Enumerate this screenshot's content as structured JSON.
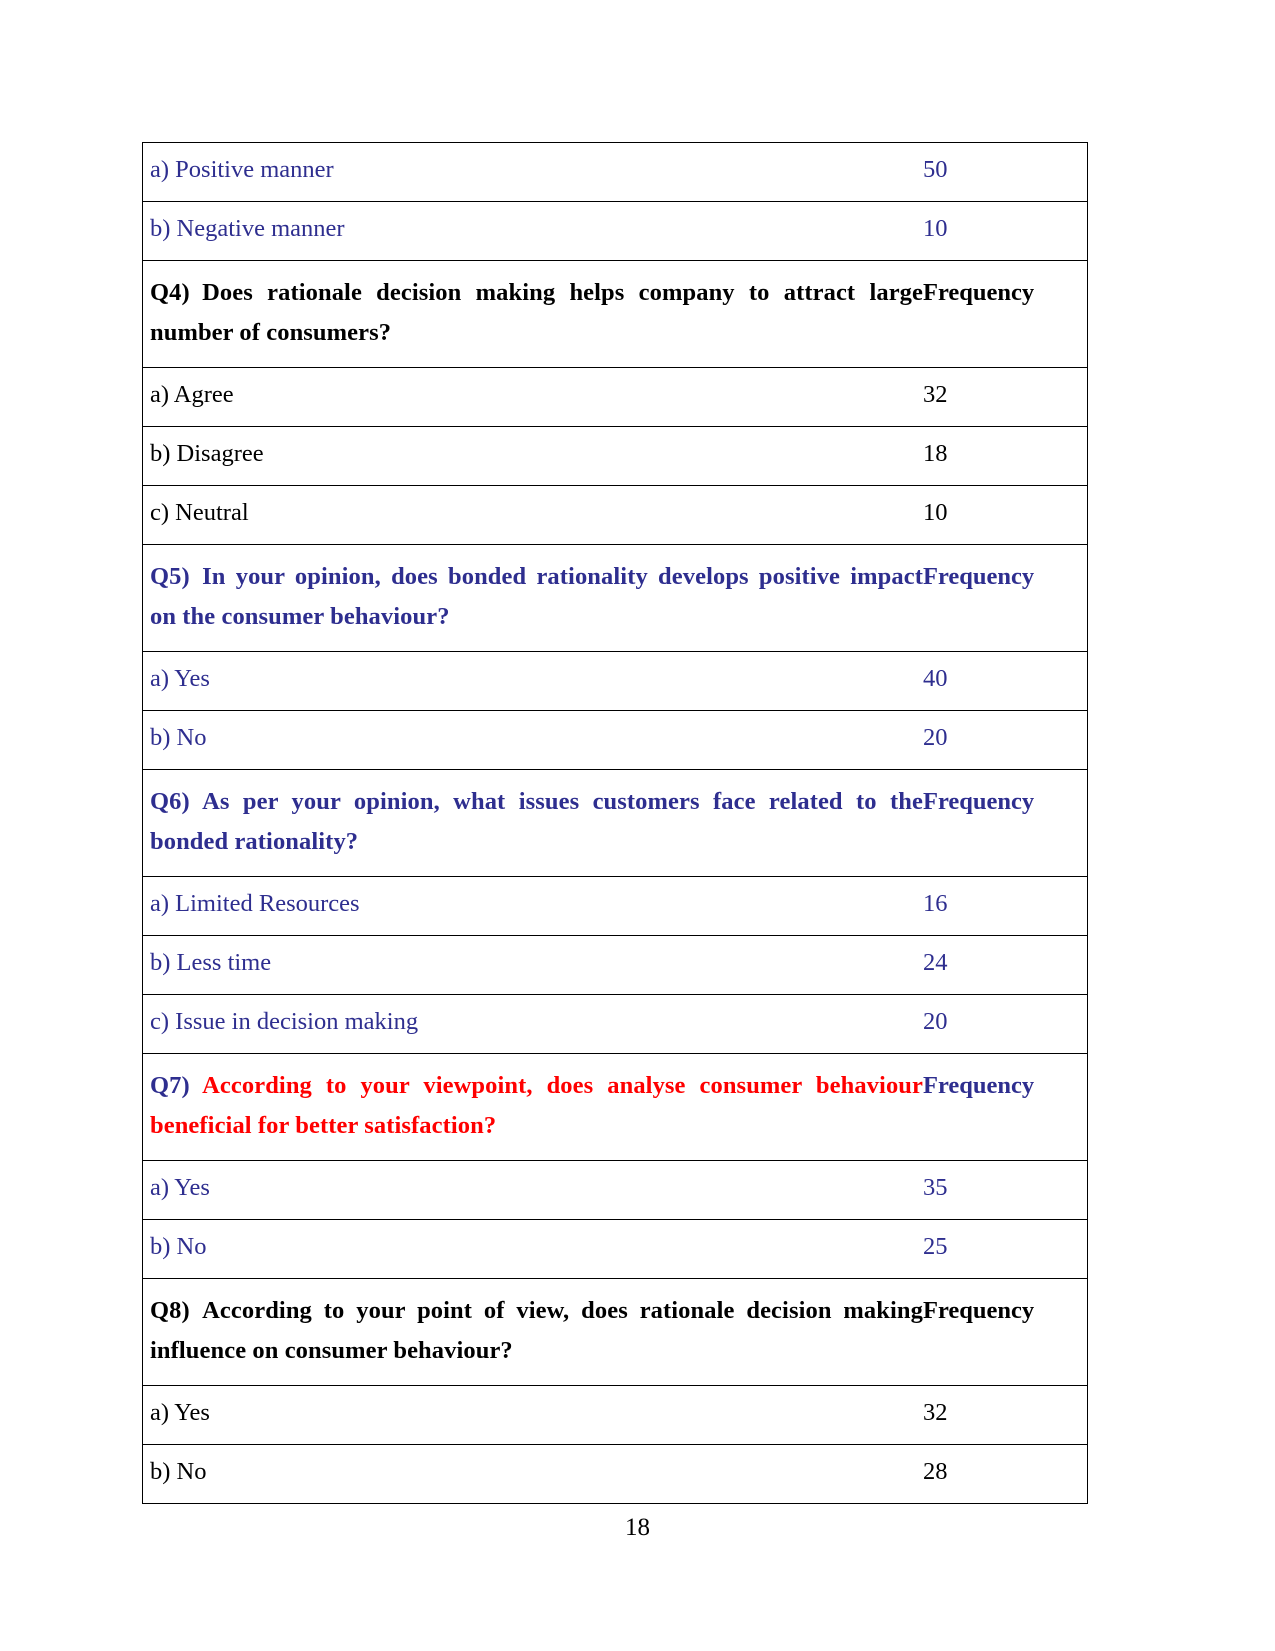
{
  "document": {
    "page_number": "18",
    "colors": {
      "blue": "#2E2E8F",
      "red": "#FF0000",
      "black": "#000000",
      "border": "#000000",
      "background": "#FFFFFF"
    }
  },
  "table": {
    "frequency_header_label": "Frequency",
    "rows": [
      {
        "kind": "answer",
        "label": "a) Positive manner",
        "frequency": "50",
        "label_color": "blue",
        "frequency_color": "blue"
      },
      {
        "kind": "answer",
        "label": "b) Negative manner",
        "frequency": "10",
        "label_color": "blue",
        "frequency_color": "blue"
      },
      {
        "kind": "question",
        "number": "Q4)",
        "number_color": "black",
        "label": "Q4)  Does  rationale  decision  making  helps  company  to  attract  large number of consumers?",
        "question_text": "Does rationale decision making helps company to attract large number of consumers?",
        "frequency": "Frequency",
        "label_color": "black",
        "frequency_color": "black"
      },
      {
        "kind": "answer",
        "label": "a) Agree",
        "frequency": "32",
        "label_color": "black",
        "frequency_color": "black"
      },
      {
        "kind": "answer",
        "label": "b) Disagree",
        "frequency": "18",
        "label_color": "black",
        "frequency_color": "black"
      },
      {
        "kind": "answer",
        "label": "c) Neutral",
        "frequency": "10",
        "label_color": "black",
        "frequency_color": "black"
      },
      {
        "kind": "question",
        "number": "Q5)",
        "number_color": "blue",
        "label": "Q5) In your opinion, does bonded rationality develops positive impact on the consumer behaviour?",
        "question_text": "In your opinion, does bonded rationality develops positive impact on the consumer behaviour?",
        "frequency": "Frequency",
        "label_color": "blue",
        "frequency_color": "blue"
      },
      {
        "kind": "answer",
        "label": "a) Yes",
        "frequency": "40",
        "label_color": "blue",
        "frequency_color": "blue"
      },
      {
        "kind": "answer",
        "label": "b) No",
        "frequency": "20",
        "label_color": "blue",
        "frequency_color": "blue"
      },
      {
        "kind": "question",
        "number": "Q6)",
        "number_color": "blue",
        "label": "Q6) As per your opinion, what issues customers face related to the bonded rationality?",
        "question_text": "As per your opinion, what issues customers face related to the bonded rationality?",
        "frequency": "Frequency",
        "label_color": "blue",
        "frequency_color": "blue"
      },
      {
        "kind": "answer",
        "label": "a) Limited Resources",
        "frequency": "16",
        "label_color": "blue",
        "frequency_color": "blue"
      },
      {
        "kind": "answer",
        "label": "b) Less time",
        "frequency": "24",
        "label_color": "blue",
        "frequency_color": "blue"
      },
      {
        "kind": "answer",
        "label": "c) Issue in decision making",
        "frequency": "20",
        "label_color": "blue",
        "frequency_color": "blue"
      },
      {
        "kind": "question",
        "number": "Q7)",
        "number_color": "blue",
        "label": "Q7) According to your viewpoint, does analyse consumer behaviour beneficial for better satisfaction?",
        "question_text": "According  to  your  viewpoint,  does  analyse  consumer  behaviour beneficial for better satisfaction?",
        "frequency": "Frequency",
        "label_color": "red",
        "frequency_color": "blue"
      },
      {
        "kind": "answer",
        "label": "a) Yes",
        "frequency": "35",
        "label_color": "blue",
        "frequency_color": "blue"
      },
      {
        "kind": "answer",
        "label": "b) No",
        "frequency": "25",
        "label_color": "blue",
        "frequency_color": "blue"
      },
      {
        "kind": "question",
        "number": "Q8)",
        "number_color": "black",
        "label": "Q8) According to your point of view, does rationale decision making influence on consumer behaviour?",
        "question_text": "According to your point of view, does rationale decision making influence on consumer behaviour?",
        "frequency": "Frequency",
        "label_color": "black",
        "frequency_color": "black"
      },
      {
        "kind": "answer",
        "label": "a) Yes",
        "frequency": "32",
        "label_color": "black",
        "frequency_color": "black"
      },
      {
        "kind": "answer",
        "label": "b) No",
        "frequency": "28",
        "label_color": "black",
        "frequency_color": "black"
      }
    ]
  }
}
